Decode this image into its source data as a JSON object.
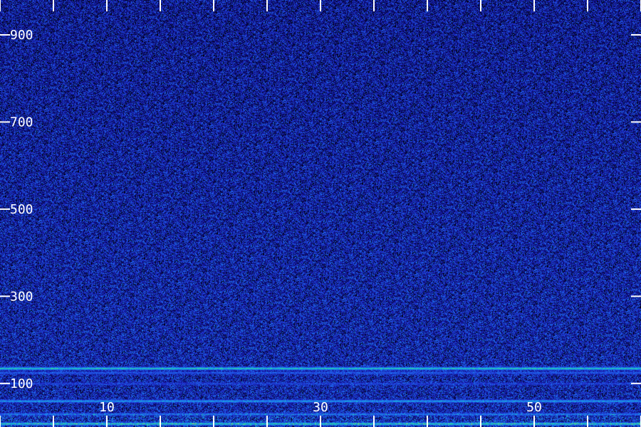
{
  "chart_data": {
    "type": "heatmap",
    "title": "",
    "xlabel": "",
    "ylabel": "",
    "xlim": [
      0,
      60
    ],
    "ylim": [
      0,
      980
    ],
    "x_ticks": [
      0,
      5,
      10,
      15,
      20,
      25,
      30,
      35,
      40,
      45,
      50,
      55,
      60
    ],
    "x_tick_labels": [
      {
        "value": 10,
        "label": "10"
      },
      {
        "value": 30,
        "label": "30"
      },
      {
        "value": 50,
        "label": "50"
      }
    ],
    "y_ticks": [
      {
        "value": 100,
        "label": "100"
      },
      {
        "value": 300,
        "label": "300"
      },
      {
        "value": 500,
        "label": "500"
      },
      {
        "value": 700,
        "label": "700"
      },
      {
        "value": 900,
        "label": "900"
      }
    ],
    "colormap": [
      "#000000",
      "#0a0a6e",
      "#1e28c8",
      "#1e6ef0",
      "#14b4dc",
      "#32dc8c",
      "#c8f03c"
    ],
    "background_level": 0.28,
    "bands": [
      {
        "freq": 135,
        "intensity": 0.9
      },
      {
        "freq": 125,
        "intensity": 0.55
      },
      {
        "freq": 100,
        "intensity": 0.45
      },
      {
        "freq": 60,
        "intensity": 0.75
      },
      {
        "freq": 30,
        "intensity": 0.6
      },
      {
        "freq": 8,
        "intensity": 0.85
      }
    ]
  }
}
